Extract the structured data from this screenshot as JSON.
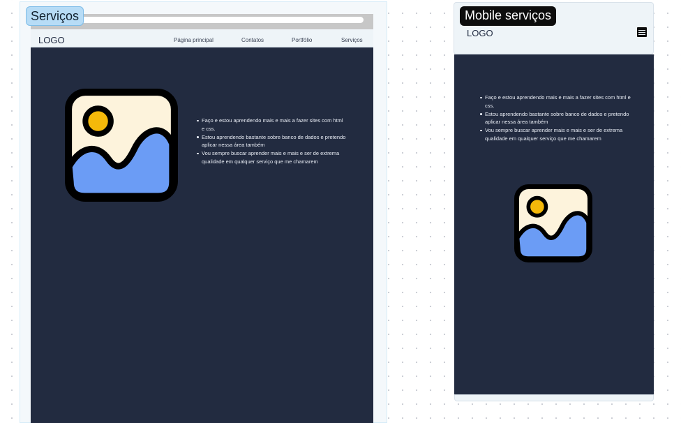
{
  "desktop": {
    "frame_label": "Serviços",
    "logo": "LOGO",
    "nav": [
      "Página principal",
      "Contatos",
      "Portfólio",
      "Serviços"
    ],
    "bullets": [
      "Faço e estou aprendendo mais e mais a fazer sites com html e css.",
      "Estou aprendendo bastante sobre banco de dados e pretendo aplicar nessa área também",
      "Vou sempre buscar aprender mais e mais e ser de extrema qualidade em qualquer serviço que me chamarem"
    ],
    "image_icon": "image-placeholder-icon"
  },
  "mobile": {
    "frame_label": "Mobile serviços",
    "logo": "LOGO",
    "menu_icon": "hamburger-menu-icon",
    "bullets": [
      "Faço e estou aprendendo mais e mais a fazer sites com html e css.",
      "Estou aprendendo bastante sobre banco de dados e pretendo aplicar nessa área também",
      "Vou sempre buscar aprender mais e mais e ser de extrema qualidade em qualquer serviço que me chamarem"
    ],
    "image_icon": "image-placeholder-icon"
  },
  "colors": {
    "page_background": "#222b40",
    "header_background": "#eef4f8",
    "desktop_label_background": "#b7dcf6",
    "mobile_label_background": "#0d0d0d",
    "icon_sky": "#fdf3dc",
    "icon_sun": "#f5b90a",
    "icon_hill": "#6b9cf5"
  }
}
